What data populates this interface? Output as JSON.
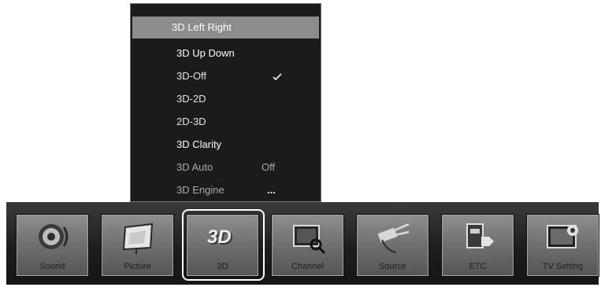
{
  "menu": {
    "items": [
      {
        "label": "3D Left Right",
        "value": ""
      },
      {
        "label": "3D Up Down",
        "value": ""
      },
      {
        "label": "3D-Off",
        "value": ""
      },
      {
        "label": "3D-2D",
        "value": ""
      },
      {
        "label": "2D-3D",
        "value": ""
      },
      {
        "label": "3D Clarity",
        "value": ""
      },
      {
        "label": "3D Auto",
        "value": "Off"
      },
      {
        "label": "3D Engine",
        "value": "..."
      }
    ],
    "selected_index": 0,
    "checked_item": "3D-Off"
  },
  "icon_bar": {
    "tiles": [
      {
        "label": "Sound",
        "icon": "speaker-icon"
      },
      {
        "label": "Picture",
        "icon": "picture-icon"
      },
      {
        "label": "3D",
        "icon": "3d-icon"
      },
      {
        "label": "Channel",
        "icon": "channel-icon"
      },
      {
        "label": "Source",
        "icon": "source-icon"
      },
      {
        "label": "ETC",
        "icon": "etc-icon"
      },
      {
        "label": "TV Setting",
        "icon": "tv-setting-icon"
      }
    ],
    "focused_index": 2
  },
  "colors": {
    "menu_background": "#1b1b1b",
    "menu_selected": "#8c8c8c",
    "bar_background": "#1c1c1c",
    "tile_gray": "#7a7a7a",
    "focus_ring": "#ffffff"
  }
}
